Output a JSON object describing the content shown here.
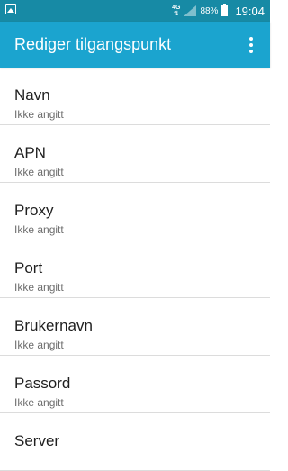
{
  "status_bar": {
    "network_type": "4G",
    "network_arrows": "⇅",
    "battery_percent": "88%",
    "time": "19:04"
  },
  "app_bar": {
    "title": "Rediger tilgangspunkt",
    "overflow_icon": "more-vert-icon"
  },
  "colors": {
    "status_bar": "#178aa5",
    "app_bar": "#1ba4cf",
    "divider": "#dcdcdc"
  },
  "settings": [
    {
      "title": "Navn",
      "summary": "Ikke angitt"
    },
    {
      "title": "APN",
      "summary": "Ikke angitt"
    },
    {
      "title": "Proxy",
      "summary": "Ikke angitt"
    },
    {
      "title": "Port",
      "summary": "Ikke angitt"
    },
    {
      "title": "Brukernavn",
      "summary": "Ikke angitt"
    },
    {
      "title": "Passord",
      "summary": "Ikke angitt"
    },
    {
      "title": "Server",
      "summary": ""
    }
  ]
}
